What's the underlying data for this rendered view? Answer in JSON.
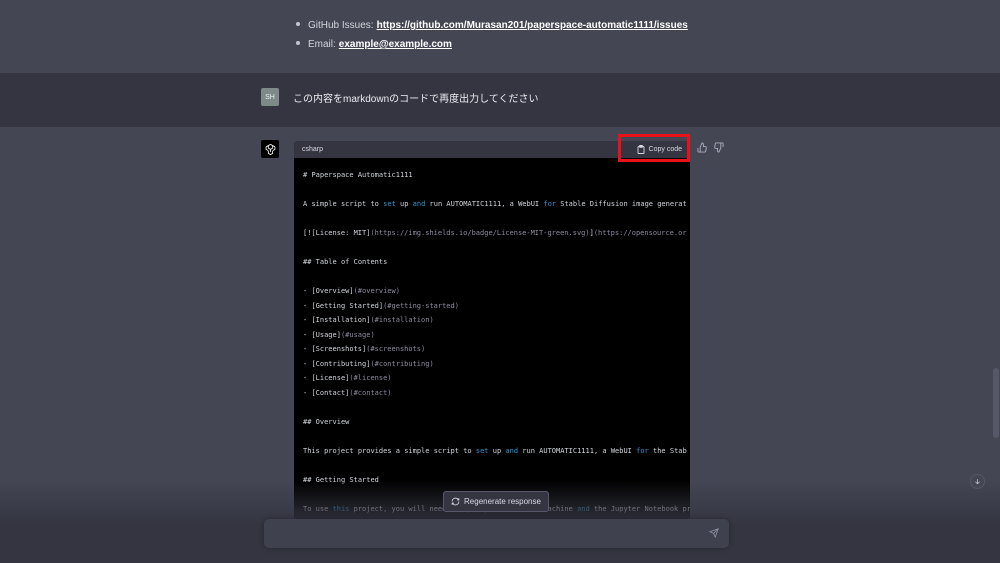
{
  "contact_bullets": [
    {
      "label": "GitHub Issues:",
      "link": "https://github.com/Murasan201/paperspace-automatic1111/issues"
    },
    {
      "label": "Email:",
      "link": "example@example.com"
    }
  ],
  "user_message": {
    "avatar": "SH",
    "text": "この内容をmarkdownのコードで再度出力してください"
  },
  "code_block": {
    "language": "csharp",
    "copy_label": "Copy code",
    "lines": [
      "# Paperspace Automatic1111",
      "",
      "A simple script to set up and run AUTOMATIC1111, a WebUI for Stable Diffusion image generat",
      "",
      "[![License: MIT](https://img.shields.io/badge/License-MIT-green.svg)](https://opensource.or",
      "",
      "## Table of Contents",
      "",
      "- [Overview](#overview)",
      "- [Getting Started](#getting-started)",
      "- [Installation](#installation)",
      "- [Usage](#usage)",
      "- [Screenshots](#screenshots)",
      "- [Contributing](#contributing)",
      "- [License](#license)",
      "- [Contact](#contact)",
      "",
      "## Overview",
      "",
      "This project provides a simple script to set up and run AUTOMATIC1111, a WebUI for the Stab",
      "",
      "## Getting Started",
      "",
      "To use this project, you will need a Paperspace Gradient machine and the Jupyter Notebook pr"
    ]
  },
  "regenerate_label": "Regenerate response",
  "colors": {
    "highlight": "#e8121b",
    "keyword": "#2e95d3",
    "comment": "#8c8ca0"
  }
}
